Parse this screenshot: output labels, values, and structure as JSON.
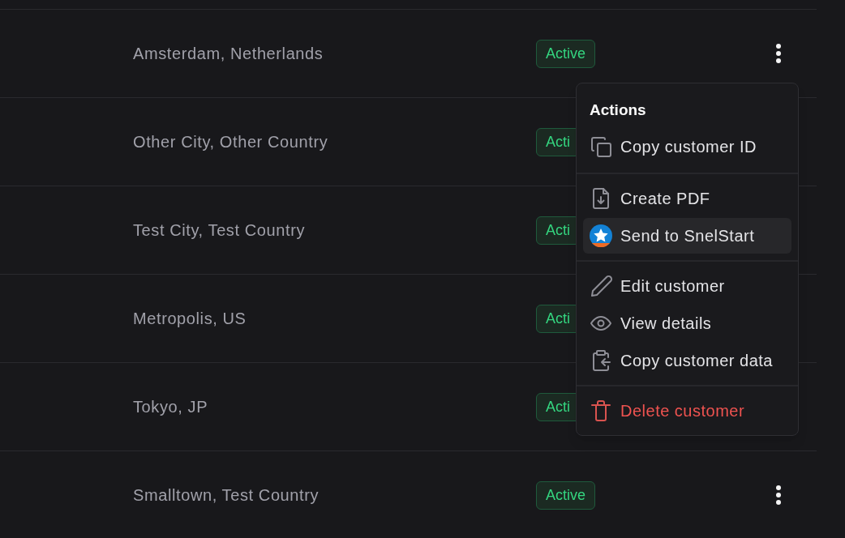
{
  "rows": [
    {
      "location": "Amsterdam, Netherlands",
      "status": "Active",
      "menu_button_visible": true
    },
    {
      "location": "Other City, Other Country",
      "status": "Acti",
      "menu_button_visible": false
    },
    {
      "location": "Test City, Test Country",
      "status": "Acti",
      "menu_button_visible": false
    },
    {
      "location": "Metropolis, US",
      "status": "Acti",
      "menu_button_visible": false
    },
    {
      "location": "Tokyo, JP",
      "status": "Acti",
      "menu_button_visible": false
    },
    {
      "location": "Smalltown, Test Country",
      "status": "Active",
      "menu_button_visible": true
    }
  ],
  "actions_menu": {
    "title": "Actions",
    "sections": [
      [
        {
          "label": "Copy customer ID",
          "kind": "normal",
          "selected": false
        }
      ],
      [
        {
          "label": "Create PDF",
          "kind": "normal",
          "selected": false
        },
        {
          "label": "Send to SnelStart",
          "kind": "normal",
          "selected": true
        }
      ],
      [
        {
          "label": "Edit customer",
          "kind": "normal",
          "selected": false
        },
        {
          "label": "View details",
          "kind": "normal",
          "selected": false
        },
        {
          "label": "Copy customer data",
          "kind": "normal",
          "selected": false
        }
      ],
      [
        {
          "label": "Delete customer",
          "kind": "danger",
          "selected": false
        }
      ]
    ]
  }
}
